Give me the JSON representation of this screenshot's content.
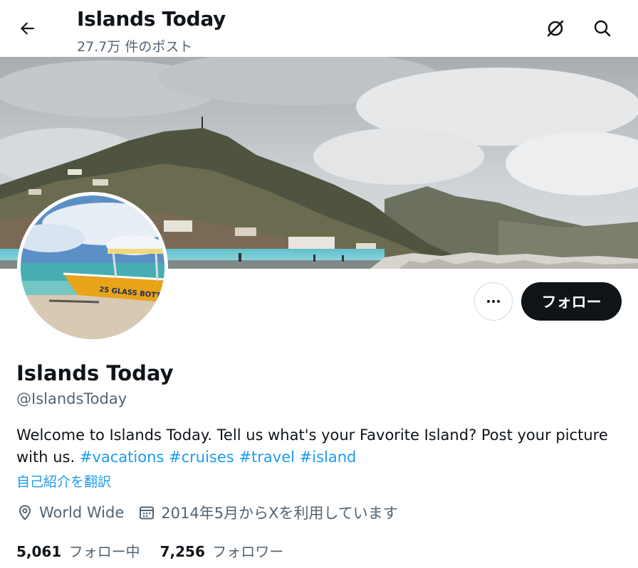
{
  "header": {
    "title": "Islands Today",
    "post_count": "27.7万 件のポスト",
    "back_icon": "arrow-left-icon",
    "grok_icon": "grok-icon",
    "search_icon": "search-icon"
  },
  "profile": {
    "name": "Islands Today",
    "handle": "@IslandsToday",
    "bio_text": "Welcome to Islands Today. Tell us what's your Favorite Island? Post your picture with us. ",
    "hashtags": [
      "#vacations",
      "#cruises",
      "#travel",
      "#island"
    ],
    "translate_label": "自己紹介を翻訳",
    "location": "World Wide",
    "joined": "2014年5月からXを利用しています",
    "following_count": "5,061",
    "following_label": "フォロー中",
    "followers_count": "7,256",
    "followers_label": "フォロワー"
  },
  "actions": {
    "follow_label": "フォロー",
    "more_icon": "more-icon"
  },
  "colors": {
    "accent": "#1d9bf0",
    "text": "#0f1419",
    "muted": "#536471",
    "follow_bg": "#0f1419"
  }
}
